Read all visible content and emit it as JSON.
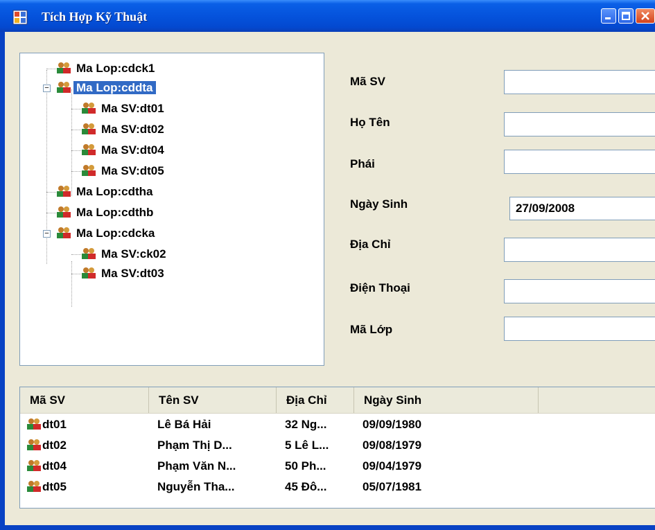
{
  "window": {
    "title": "Tích Hợp Kỹ Thuật"
  },
  "icons": {
    "app": "app-window-icon",
    "node": "users-group-icon"
  },
  "tree": {
    "nodes": [
      {
        "label": "Ma Lop:cdck1"
      },
      {
        "label": "Ma Lop:cddta",
        "expanded": true,
        "selected": true
      },
      {
        "label": "Ma SV:dt01"
      },
      {
        "label": "Ma SV:dt02"
      },
      {
        "label": "Ma SV:dt04"
      },
      {
        "label": "Ma SV:dt05"
      },
      {
        "label": "Ma Lop:cdtha"
      },
      {
        "label": "Ma Lop:cdthb"
      },
      {
        "label": "Ma Lop:cdcka",
        "expanded": true
      },
      {
        "label": "Ma SV:ck02"
      },
      {
        "label": "Ma SV:dt03"
      }
    ]
  },
  "form": {
    "ma_sv": {
      "label": "Mã SV",
      "value": ""
    },
    "ho_ten": {
      "label": "Họ Tên",
      "value": ""
    },
    "phai": {
      "label": "Phái",
      "value": ""
    },
    "ngay_sinh": {
      "label": "Ngày Sinh",
      "value": "27/09/2008"
    },
    "dia_chi": {
      "label": "Địa Chỉ",
      "value": ""
    },
    "dien_thoai": {
      "label": "Điện Thoại",
      "value": ""
    },
    "ma_lop": {
      "label": "Mã Lớp",
      "value": ""
    }
  },
  "table": {
    "headers": [
      "Mã SV",
      "Tên SV",
      "Địa Chỉ",
      "Ngày Sinh"
    ],
    "rows": [
      {
        "ma_sv": "dt01",
        "ten_sv": "Lê Bá Hải",
        "dia_chi": "32 Ng...",
        "ngay_sinh": "09/09/1980"
      },
      {
        "ma_sv": "dt02",
        "ten_sv": "Phạm Thị D...",
        "dia_chi": "5 Lê L...",
        "ngay_sinh": "09/08/1979"
      },
      {
        "ma_sv": "dt04",
        "ten_sv": "Phạm Văn N...",
        "dia_chi": "50 Ph...",
        "ngay_sinh": "09/04/1979"
      },
      {
        "ma_sv": "dt05",
        "ten_sv": "Nguyễn Tha...",
        "dia_chi": "45 Đô...",
        "ngay_sinh": "05/07/1981"
      }
    ]
  },
  "colors": {
    "titlebar": "#0553dc",
    "client": "#ece9d8",
    "selection": "#316ac5"
  }
}
